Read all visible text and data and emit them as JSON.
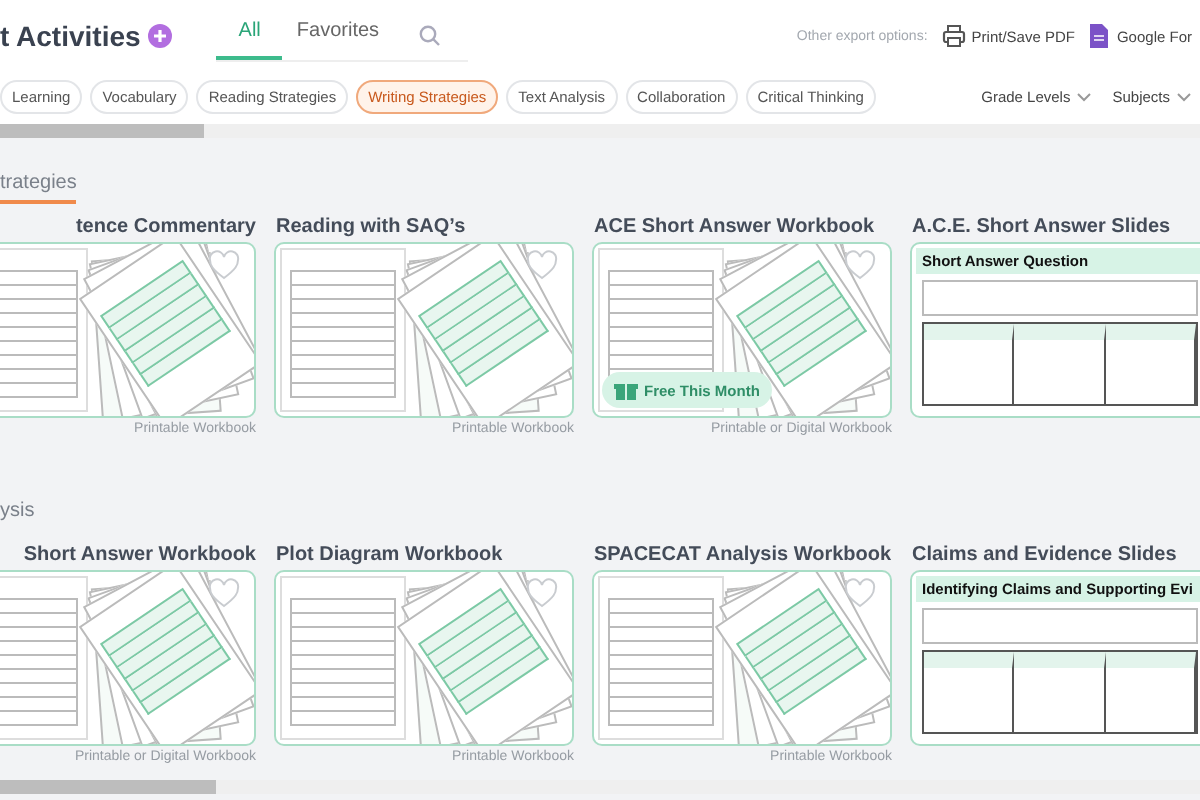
{
  "header": {
    "title": "t Activities",
    "tabs": [
      {
        "label": "All",
        "selected": true
      },
      {
        "label": "Favorites",
        "selected": false
      }
    ],
    "export_label": "Other export options:",
    "export_options": [
      {
        "kind": "print",
        "label": "Print/Save PDF"
      },
      {
        "kind": "form",
        "label": "Google For"
      }
    ]
  },
  "filters": {
    "chips": [
      {
        "label": "Learning",
        "selected": false
      },
      {
        "label": "Vocabulary",
        "selected": false
      },
      {
        "label": "Reading Strategies",
        "selected": false
      },
      {
        "label": "Writing Strategies",
        "selected": true
      },
      {
        "label": "Text Analysis",
        "selected": false
      },
      {
        "label": "Collaboration",
        "selected": false
      },
      {
        "label": "Critical Thinking",
        "selected": false
      }
    ],
    "dropdowns": [
      {
        "label": "Grade Levels"
      },
      {
        "label": "Subjects"
      }
    ]
  },
  "sections": [
    {
      "title": "trategies",
      "underline": true,
      "cards": [
        {
          "title": "tence Commentary",
          "kind": "workbook",
          "caption": "Printable Workbook"
        },
        {
          "title": "Reading with SAQ’s",
          "kind": "workbook",
          "caption": "Printable Workbook"
        },
        {
          "title": "ACE Short Answer Workbook",
          "kind": "workbook",
          "badge": "Free This Month",
          "caption": "Printable or Digital Workbook"
        },
        {
          "title": "A.C.E. Short Answer Slides",
          "kind": "slides",
          "slide_heading": "Short Answer Question"
        }
      ]
    },
    {
      "title": "ysis",
      "underline": false,
      "cards": [
        {
          "title": "Short Answer Workbook",
          "kind": "workbook",
          "caption": "Printable or Digital Workbook"
        },
        {
          "title": "Plot Diagram Workbook",
          "kind": "workbook",
          "caption": "Printable Workbook"
        },
        {
          "title": "SPACECAT Analysis Workbook",
          "kind": "workbook",
          "caption": "Printable Workbook"
        },
        {
          "title": "Claims and Evidence Slides",
          "kind": "slides",
          "slide_heading": "Identifying Claims and Supporting Evi"
        }
      ]
    }
  ]
}
